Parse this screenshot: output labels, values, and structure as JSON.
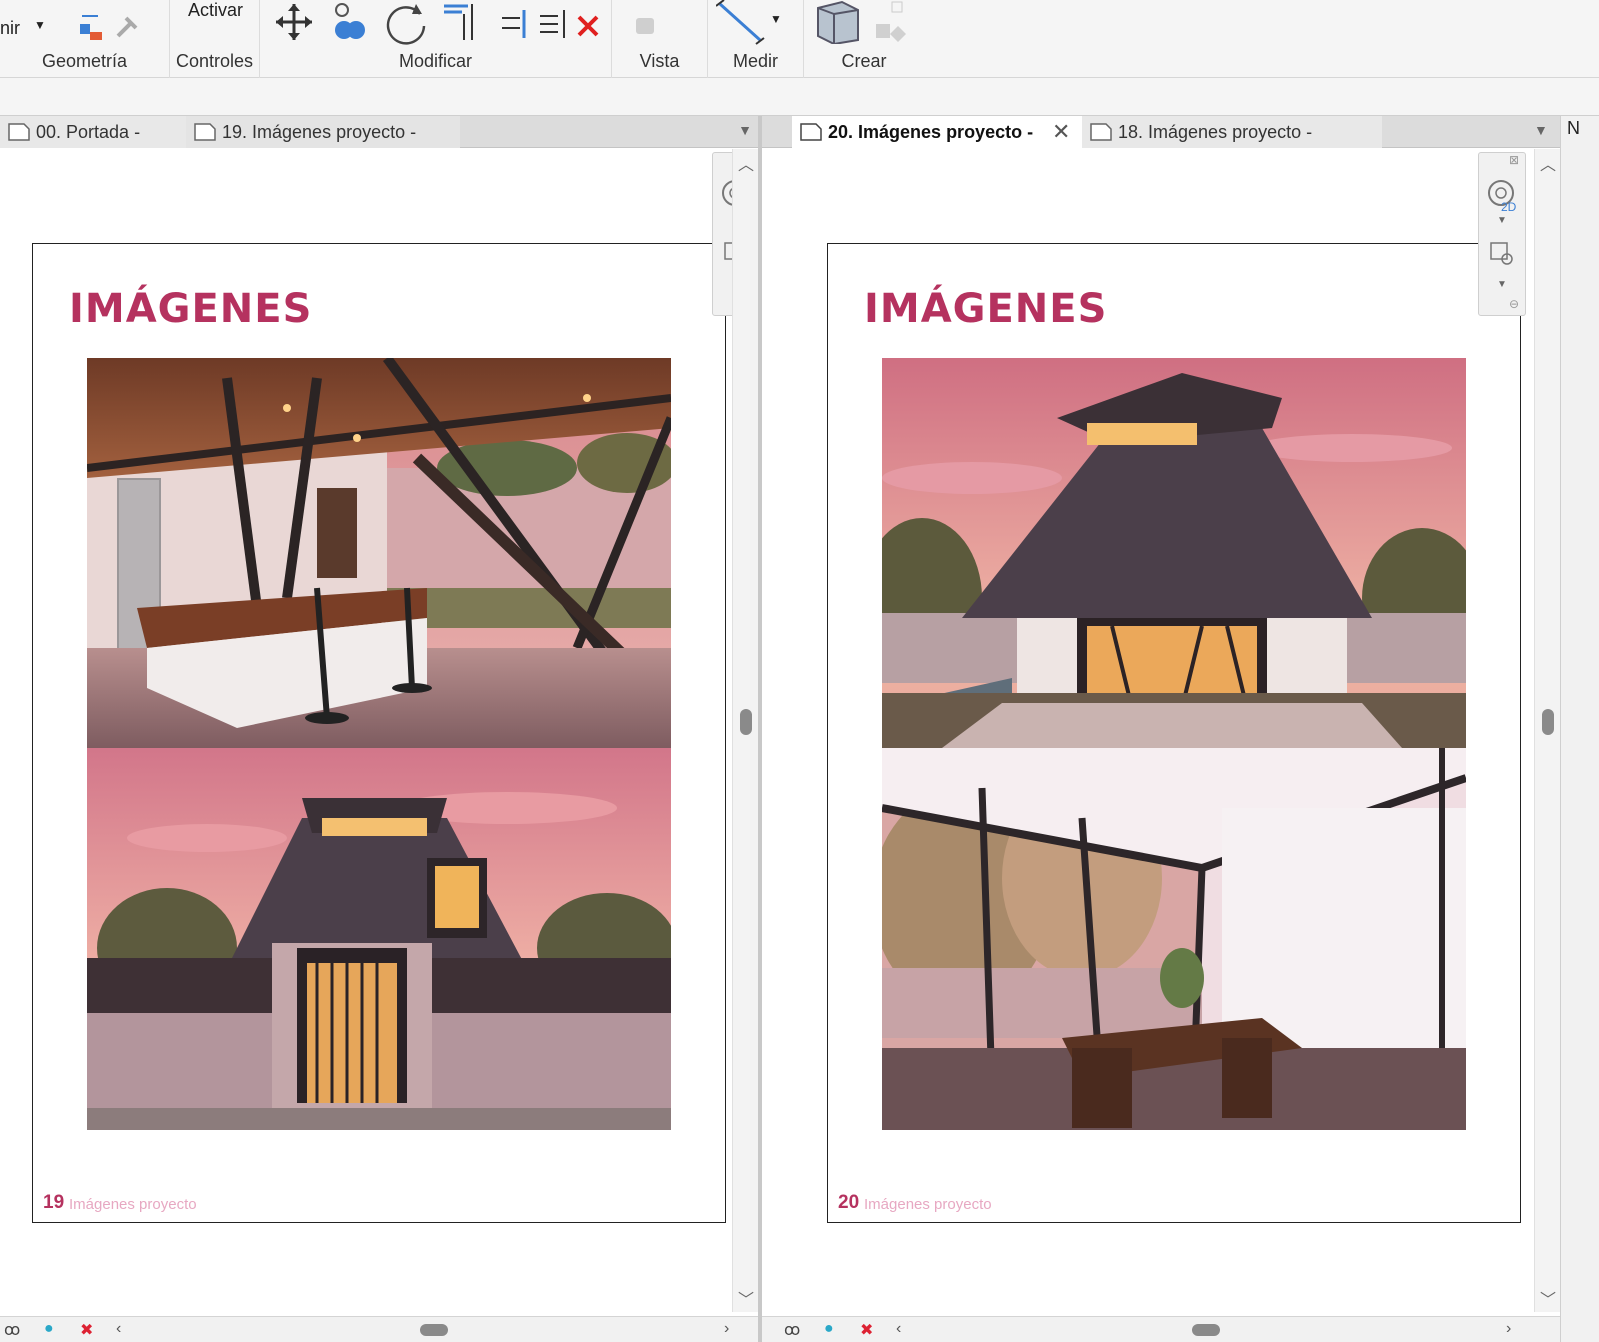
{
  "ribbon": {
    "panels": [
      {
        "label": "Geometría"
      },
      {
        "label": "Controles"
      },
      {
        "label": "Modificar"
      },
      {
        "label": "Vista"
      },
      {
        "label": "Medir"
      },
      {
        "label": "Crear"
      }
    ],
    "cut_label": "nir",
    "activar_label": "Activar"
  },
  "left_pane": {
    "tabs": [
      {
        "label": "00. Portada -"
      },
      {
        "label": "19. Imágenes proyecto -"
      }
    ],
    "sheet": {
      "title": "IMÁGENES",
      "page_number": "19",
      "caption": "Imágenes proyecto",
      "images": [
        "kitchen-interior-photo",
        "house-front-photo"
      ]
    }
  },
  "right_pane": {
    "tabs": [
      {
        "label": "20. Imágenes proyecto -",
        "active": true
      },
      {
        "label": "18. Imágenes proyecto -"
      }
    ],
    "sheet": {
      "title": "IMÁGENES",
      "page_number": "20",
      "caption": "Imágenes proyecto",
      "images": [
        "house-rear-photo",
        "dining-interior-photo"
      ]
    }
  },
  "edge_label": "N",
  "navbar": {
    "mode_badge": "2D"
  },
  "colors": {
    "accent": "#b5325f",
    "caption": "#e7a8c2",
    "sky": "#e8a0a8",
    "roof": "#4b3f4a"
  }
}
